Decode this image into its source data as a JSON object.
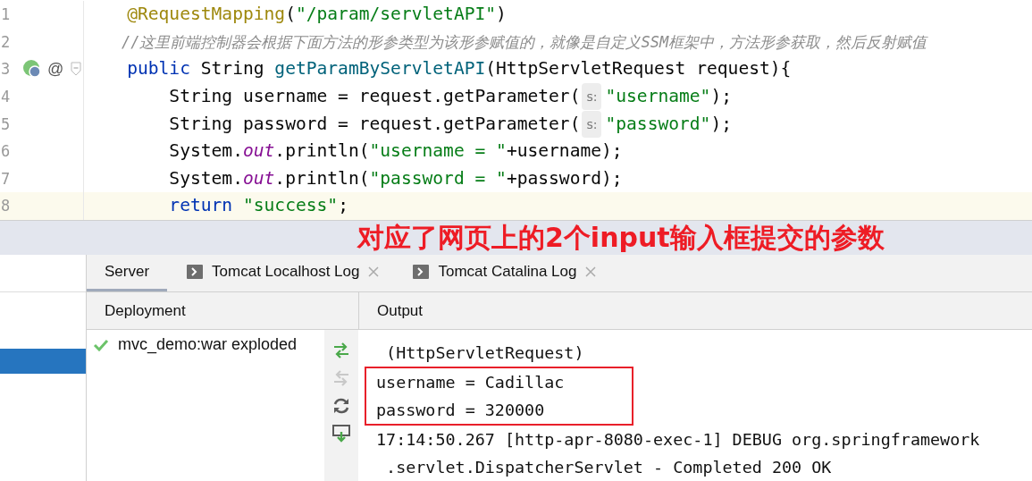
{
  "editor": {
    "lines": [
      {
        "number": "1",
        "current": false,
        "tokens": [
          {
            "kind": "annotation",
            "text": "    @RequestMapping"
          },
          {
            "kind": "plain",
            "text": "("
          },
          {
            "kind": "string",
            "text": "\"/param/servletAPI\""
          },
          {
            "kind": "plain",
            "text": ")"
          }
        ]
      },
      {
        "number": "2",
        "current": false,
        "tokens": [
          {
            "kind": "comment",
            "text": "    //这里前端控制器会根据下面方法的形参类型为该形参赋值的，就像是自定义SSM框架中，方法形参获取，然后反射赋值"
          }
        ]
      },
      {
        "number": "3",
        "current": false,
        "gutter": {
          "symbol": "@"
        },
        "tokens": [
          {
            "kind": "keyword",
            "text": "    public"
          },
          {
            "kind": "plain",
            "text": " String "
          },
          {
            "kind": "method",
            "text": "getParamByServletAPI"
          },
          {
            "kind": "plain",
            "text": "(HttpServletRequest request){"
          }
        ]
      },
      {
        "number": "4",
        "current": false,
        "tokens": [
          {
            "kind": "plain",
            "text": "        String username = request.getParameter("
          },
          {
            "kind": "hint",
            "text": "s:"
          },
          {
            "kind": "string",
            "text": "\"username\""
          },
          {
            "kind": "plain",
            "text": ");"
          }
        ]
      },
      {
        "number": "5",
        "current": false,
        "tokens": [
          {
            "kind": "plain",
            "text": "        String password = request.getParameter("
          },
          {
            "kind": "hint",
            "text": "s:"
          },
          {
            "kind": "string",
            "text": "\"password\""
          },
          {
            "kind": "plain",
            "text": ");"
          }
        ]
      },
      {
        "number": "6",
        "current": false,
        "tokens": [
          {
            "kind": "plain",
            "text": "        System."
          },
          {
            "kind": "field",
            "text": "out"
          },
          {
            "kind": "plain",
            "text": ".println("
          },
          {
            "kind": "string",
            "text": "\"username = \""
          },
          {
            "kind": "plain",
            "text": "+username);"
          }
        ]
      },
      {
        "number": "7",
        "current": false,
        "tokens": [
          {
            "kind": "plain",
            "text": "        System."
          },
          {
            "kind": "field",
            "text": "out"
          },
          {
            "kind": "plain",
            "text": ".println("
          },
          {
            "kind": "string",
            "text": "\"password = \""
          },
          {
            "kind": "plain",
            "text": "+password);"
          }
        ]
      },
      {
        "number": "8",
        "current": true,
        "tokens": [
          {
            "kind": "keyword",
            "text": "        return"
          },
          {
            "kind": "string",
            "text": " \"success\""
          },
          {
            "kind": "plain",
            "text": ";"
          }
        ]
      }
    ]
  },
  "annotation": "对应了网页上的2个input输入框提交的参数",
  "left_panel": {
    "rows": [
      {
        "selected": false
      },
      {
        "selected": true
      }
    ]
  },
  "tabs": [
    {
      "label": "Server",
      "selected": true,
      "closable": false,
      "icon": false
    },
    {
      "label": "Tomcat Localhost Log",
      "selected": false,
      "closable": true,
      "icon": true
    },
    {
      "label": "Tomcat Catalina Log",
      "selected": false,
      "closable": true,
      "icon": true
    }
  ],
  "deployment": {
    "header": "Deployment",
    "items": [
      {
        "label": "mvc_demo:war exploded",
        "ok": true
      }
    ]
  },
  "toolbar": [
    {
      "kind": "deploy",
      "disabled": false
    },
    {
      "kind": "undeploy",
      "disabled": true
    },
    {
      "kind": "refresh",
      "disabled": false
    },
    {
      "kind": "download",
      "disabled": false
    }
  ],
  "output": {
    "header": "Output",
    "blocks": [
      {
        "highlighted": false,
        "lines": [
          " (HttpServletRequest)"
        ]
      },
      {
        "highlighted": true,
        "lines": [
          "username = Cadillac",
          "password = 320000"
        ]
      },
      {
        "highlighted": false,
        "lines": [
          "17:14:50.267 [http-apr-8080-exec-1] DEBUG org.springframework",
          " .servlet.DispatcherServlet - Completed 200 OK"
        ]
      }
    ]
  }
}
